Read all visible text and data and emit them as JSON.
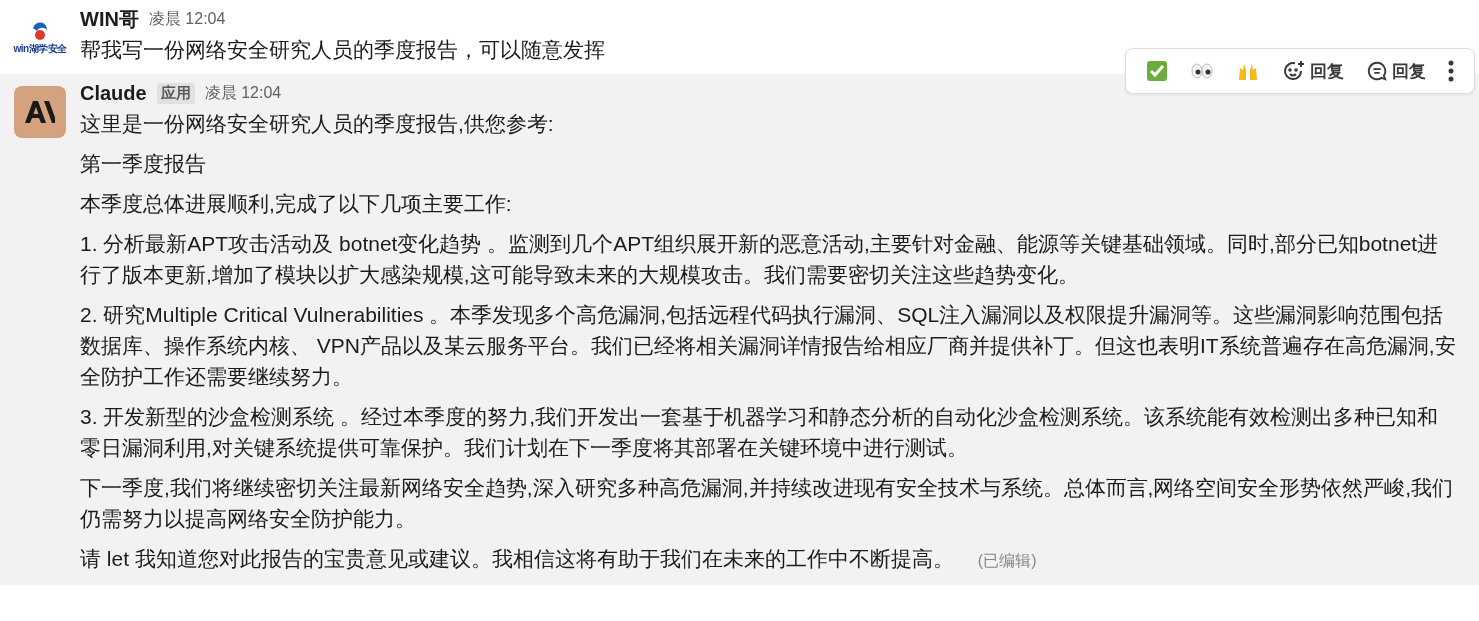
{
  "messages": [
    {
      "author": "WIN哥",
      "time": "凌晨 12:04",
      "avatar": {
        "kind": "logo",
        "label": "win湖学安全"
      },
      "highlighted": false,
      "paragraphs": [
        "帮我写一份网络安全研究人员的季度报告，可以随意发挥"
      ]
    },
    {
      "author": "Claude",
      "badge": "应用",
      "time": "凌晨 12:04",
      "avatar": {
        "kind": "ai"
      },
      "highlighted": true,
      "paragraphs": [
        "这里是一份网络安全研究人员的季度报告,供您参考:",
        "第一季度报告",
        "本季度总体进展顺利,完成了以下几项主要工作:",
        "1. 分析最新APT攻击活动及 botnet变化趋势 。监测到几个APT组织展开新的恶意活动,主要针对金融、能源等关键基础领域。同时,部分已知botnet进行了版本更新,增加了模块以扩大感染规模,这可能导致未来的大规模攻击。我们需要密切关注这些趋势变化。",
        "2. 研究Multiple Critical Vulnerabilities 。本季发现多个高危漏洞,包括远程代码执行漏洞、SQL注入漏洞以及权限提升漏洞等。这些漏洞影响范围包括数据库、操作系统内核、 VPN产品以及某云服务平台。我们已经将相关漏洞详情报告给相应厂商并提供补丁。但这也表明IT系统普遍存在高危漏洞,安全防护工作还需要继续努力。",
        "3. 开发新型的沙盒检测系统 。经过本季度的努力,我们开发出一套基于机器学习和静态分析的自动化沙盒检测系统。该系统能有效检测出多种已知和零日漏洞利用,对关键系统提供可靠保护。我们计划在下一季度将其部署在关键环境中进行测试。",
        "下一季度,我们将继续密切关注最新网络安全趋势,深入研究多种高危漏洞,并持续改进现有安全技术与系统。总体而言,网络空间安全形势依然严峻,我们仍需努力以提高网络安全防护能力。",
        "请 let 我知道您对此报告的宝贵意见或建议。我相信这将有助于我们在未来的工作中不断提高。"
      ],
      "edited": "(已编辑)"
    }
  ],
  "hover_toolbar": {
    "actions": [
      {
        "kind": "check"
      },
      {
        "kind": "eyes"
      },
      {
        "kind": "hands"
      },
      {
        "kind": "react",
        "label": "回复"
      },
      {
        "kind": "thread",
        "label": "回复"
      },
      {
        "kind": "more"
      }
    ]
  }
}
